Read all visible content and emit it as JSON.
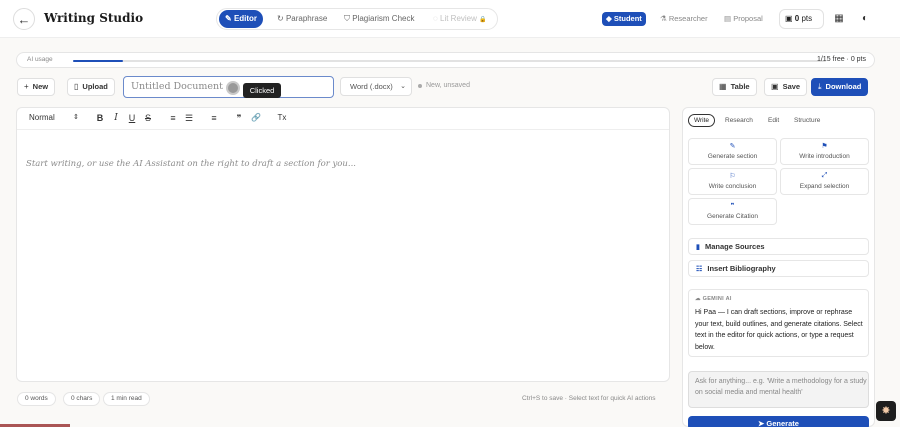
{
  "header": {
    "title": "Writing Studio",
    "back_icon": "←",
    "tabs": [
      {
        "label": "Editor",
        "icon": "✎",
        "active": true
      },
      {
        "label": "Paraphrase",
        "icon": "↻"
      },
      {
        "label": "Plagiarism Check",
        "icon": "⛉"
      },
      {
        "label": "Lit Review",
        "icon": "◌",
        "lock": "🔒",
        "disabled": true
      }
    ],
    "roles": [
      {
        "label": "Student",
        "icon": "◆",
        "active": true
      },
      {
        "label": "Researcher",
        "icon": "⚗"
      },
      {
        "label": "Proposal",
        "icon": "▤"
      }
    ],
    "points": {
      "value": "0",
      "unit": "pts",
      "icon": "▣"
    },
    "inbox_icon": "▦",
    "theme_icon": "◐"
  },
  "usage": {
    "label": "AI usage",
    "free_text": "1/15 free · 0 pts",
    "fraction": 0.0667
  },
  "doc_toolbar": {
    "new_label": "New",
    "new_icon": "+",
    "upload_label": "Upload",
    "upload_icon": "▯",
    "title_placeholder": "Untitled Document",
    "tooltip": "Clicked",
    "format": "Word (.docx)",
    "status": "New, unsaved",
    "table_label": "Table",
    "table_icon": "▦",
    "save_label": "Save",
    "save_icon": "▣",
    "download_label": "Download",
    "download_icon": "⤓"
  },
  "editor": {
    "style_select": "Normal",
    "tools": [
      "B",
      "I",
      "U",
      "S",
      "≡",
      "☰",
      "≡",
      "❞",
      "🔗",
      "Tx"
    ],
    "placeholder": "Start writing, or use the AI Assistant on the right to draft a section for you..."
  },
  "footer": {
    "words": "0 words",
    "chars": "0 chars",
    "read": "1 min read",
    "hint": "Ctrl+S to save · Select text for quick AI actions"
  },
  "panel": {
    "tabs": [
      "Write",
      "Research",
      "Edit",
      "Structure"
    ],
    "actions": [
      {
        "label": "Generate section",
        "icon": "✎"
      },
      {
        "label": "Write introduction",
        "icon": "⚑"
      },
      {
        "label": "Write conclusion",
        "icon": "⚐"
      },
      {
        "label": "Expand selection",
        "icon": "⤢"
      },
      {
        "label": "Generate Citation",
        "icon": "❞"
      }
    ],
    "manage_sources": {
      "label": "Manage Sources",
      "icon": "▮"
    },
    "insert_bibliography": {
      "label": "Insert Bibliography",
      "icon": "☷"
    },
    "ai_label": "GEMINI AI",
    "ai_message": "Hi Paa — I can draft sections, improve or rephrase your text, build outlines, and generate citations. Select text in the editor for quick actions, or type a request below.",
    "ask_placeholder": "Ask for anything... e.g. 'Write a methodology for a study on social media and mental health'",
    "generate_label": "Generate",
    "generate_icon": "➤"
  },
  "corner_icon": "✸",
  "colors": {
    "accent": "#1e4fb8"
  }
}
